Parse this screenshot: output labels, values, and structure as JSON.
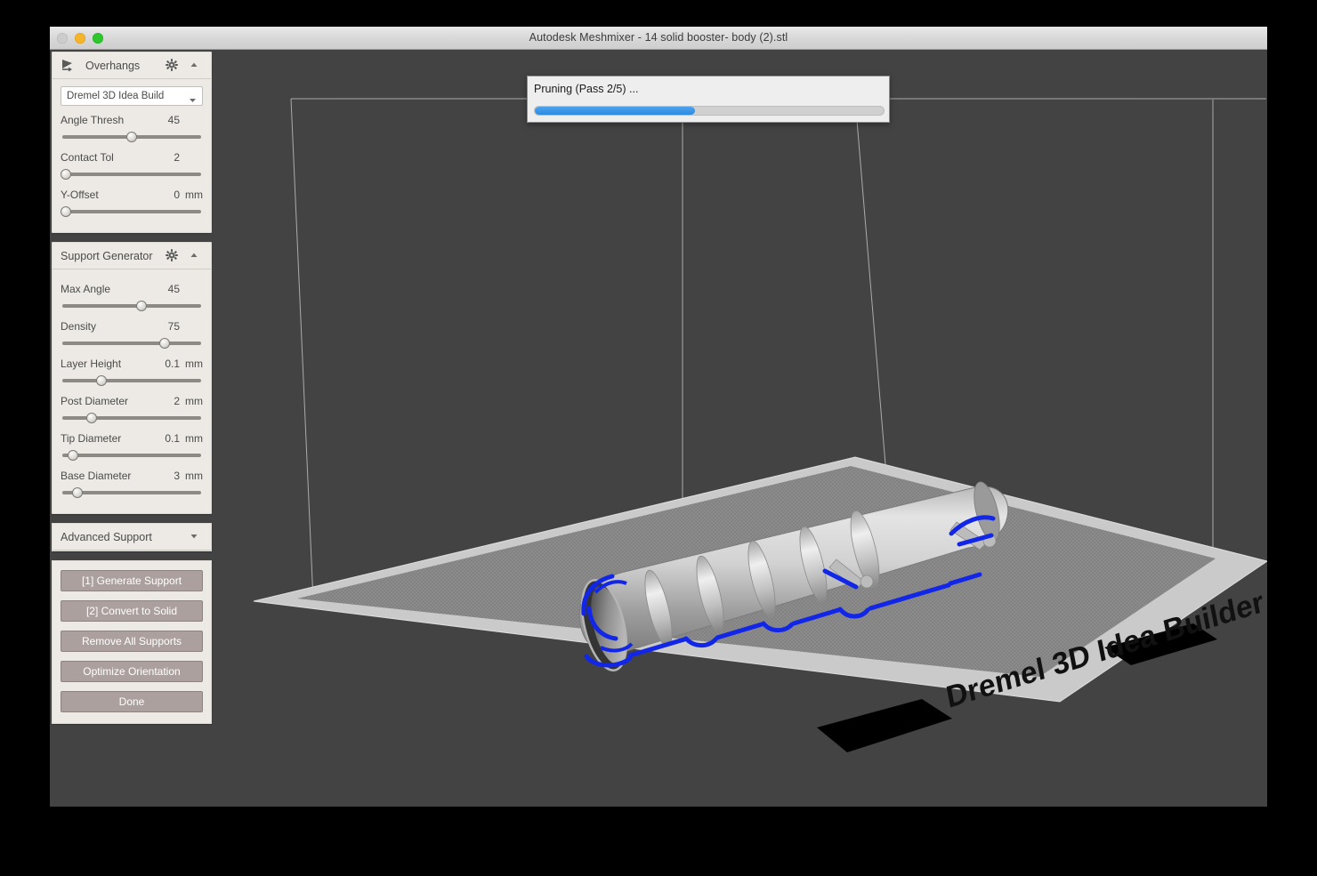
{
  "window": {
    "title": "Autodesk Meshmixer - 14 solid booster- body (2).stl",
    "controls": {
      "close": "close-button",
      "minimize": "minimize-button",
      "maximize": "maximize-button"
    }
  },
  "progress_dialog": {
    "label": "Pruning (Pass 2/5) ...",
    "percent": 46,
    "fill_color": "#2d8ae0"
  },
  "panels": {
    "overhangs": {
      "title": "Overhangs",
      "icon": "overhang-flag-icon",
      "gear_icon": "gear-icon",
      "collapse_icon": "chevron-up-icon",
      "printer_dropdown": {
        "value": "Dremel 3D Idea Build",
        "caret_icon": "chevron-down-icon"
      },
      "params": [
        {
          "label": "Angle Thresh",
          "value": "45",
          "unit": "",
          "knob_pct": 50
        },
        {
          "label": "Contact Tol",
          "value": "2",
          "unit": "",
          "knob_pct": 4
        },
        {
          "label": "Y-Offset",
          "value": "0",
          "unit": "mm",
          "knob_pct": 4
        }
      ]
    },
    "support_generator": {
      "title": "Support Generator",
      "gear_icon": "gear-icon",
      "collapse_icon": "chevron-up-icon",
      "params": [
        {
          "label": "Max Angle",
          "value": "45",
          "unit": "",
          "knob_pct": 57
        },
        {
          "label": "Density",
          "value": "75",
          "unit": "",
          "knob_pct": 73
        },
        {
          "label": "Layer Height",
          "value": "0.1",
          "unit": "mm",
          "knob_pct": 29
        },
        {
          "label": "Post Diameter",
          "value": "2",
          "unit": "mm",
          "knob_pct": 22
        },
        {
          "label": "Tip Diameter",
          "value": "0.1",
          "unit": "mm",
          "knob_pct": 9
        },
        {
          "label": "Base Diameter",
          "value": "3",
          "unit": "mm",
          "knob_pct": 12
        }
      ]
    },
    "advanced_support": {
      "title": "Advanced Support",
      "expand_icon": "chevron-down-icon"
    }
  },
  "actions": {
    "buttons": [
      "[1] Generate Support",
      "[2] Convert to Solid",
      "Remove All Supports",
      "Optimize Orientation",
      "Done"
    ],
    "button_color": "#aba09d"
  },
  "viewport": {
    "background_color": "#434343",
    "build_plate_label": "Dremel 3D Idea Builder",
    "model_name": "14 solid booster- body (2)",
    "overhang_highlight_color": "#1226e8",
    "contour_color": "#d01010",
    "plate_border_color": "#cacaca",
    "plate_surface_color": "#8c8c8c",
    "build_volume_line_color": "#bdbdbd"
  }
}
